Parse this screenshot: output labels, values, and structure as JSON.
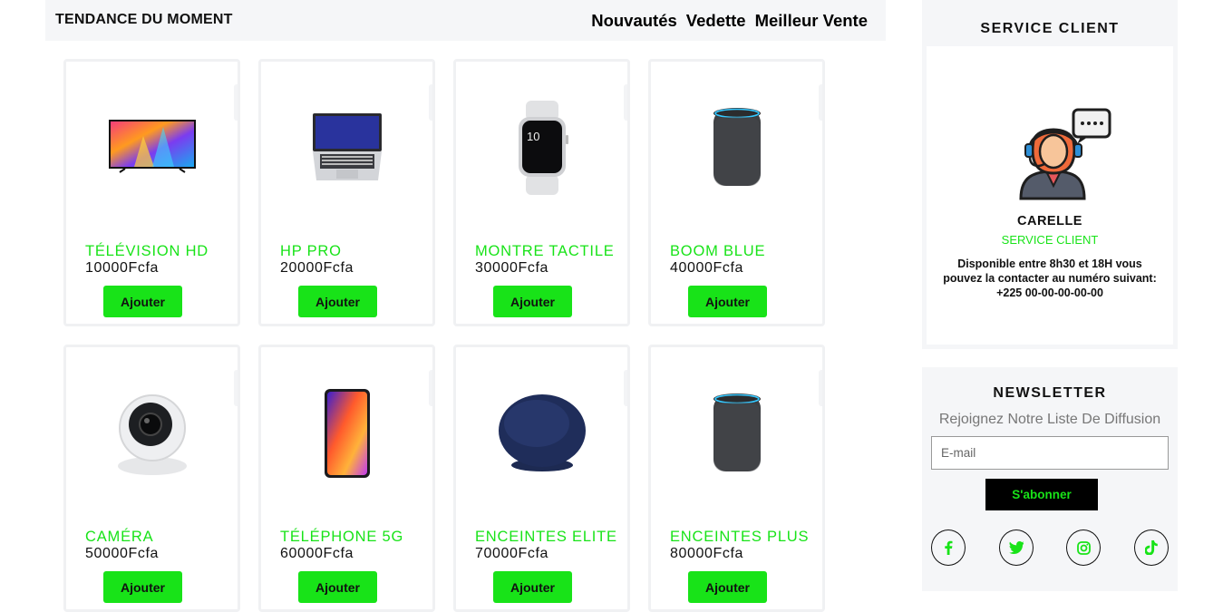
{
  "header": {
    "title": "TENDANCE DU MOMENT",
    "filters": [
      "Nouvautés",
      "Vedette",
      "Meilleur Vente"
    ]
  },
  "products": [
    {
      "name": "Télévision HD",
      "price": "10000Fcfa",
      "button": "Ajouter",
      "icon": "tv"
    },
    {
      "name": "HP Pro",
      "price": "20000Fcfa",
      "button": "Ajouter",
      "icon": "laptop"
    },
    {
      "name": "Montre tactile",
      "price": "30000Fcfa",
      "button": "Ajouter",
      "icon": "smartwatch"
    },
    {
      "name": "Boom blue",
      "price": "40000Fcfa",
      "button": "Ajouter",
      "icon": "smart-speaker"
    },
    {
      "name": "Caméra",
      "price": "50000Fcfa",
      "button": "Ajouter",
      "icon": "camera"
    },
    {
      "name": "Téléphone 5G",
      "price": "60000Fcfa",
      "button": "Ajouter",
      "icon": "smartphone"
    },
    {
      "name": "Enceintes elite",
      "price": "70000Fcfa",
      "button": "Ajouter",
      "icon": "wireless-charger"
    },
    {
      "name": "Enceintes plus",
      "price": "80000Fcfa",
      "button": "Ajouter",
      "icon": "smart-speaker"
    }
  ],
  "service": {
    "title": "SERVICE CLIENT",
    "agent_name": "CARELLE",
    "agent_role": "SERVICE CLIENT",
    "info": "Disponible entre 8h30 et 18H vous pouvez la contacter au numéro suivant: +225 00-00-00-00-00"
  },
  "newsletter": {
    "title": "NEWSLETTER",
    "subtitle": "Rejoignez Notre Liste De Diffusion",
    "email_placeholder": "E-mail",
    "button": "S'abonner",
    "socials": [
      "facebook",
      "twitter",
      "instagram",
      "tiktok"
    ]
  },
  "colors": {
    "accent": "#18e318",
    "panel": "#f5f6f8"
  }
}
